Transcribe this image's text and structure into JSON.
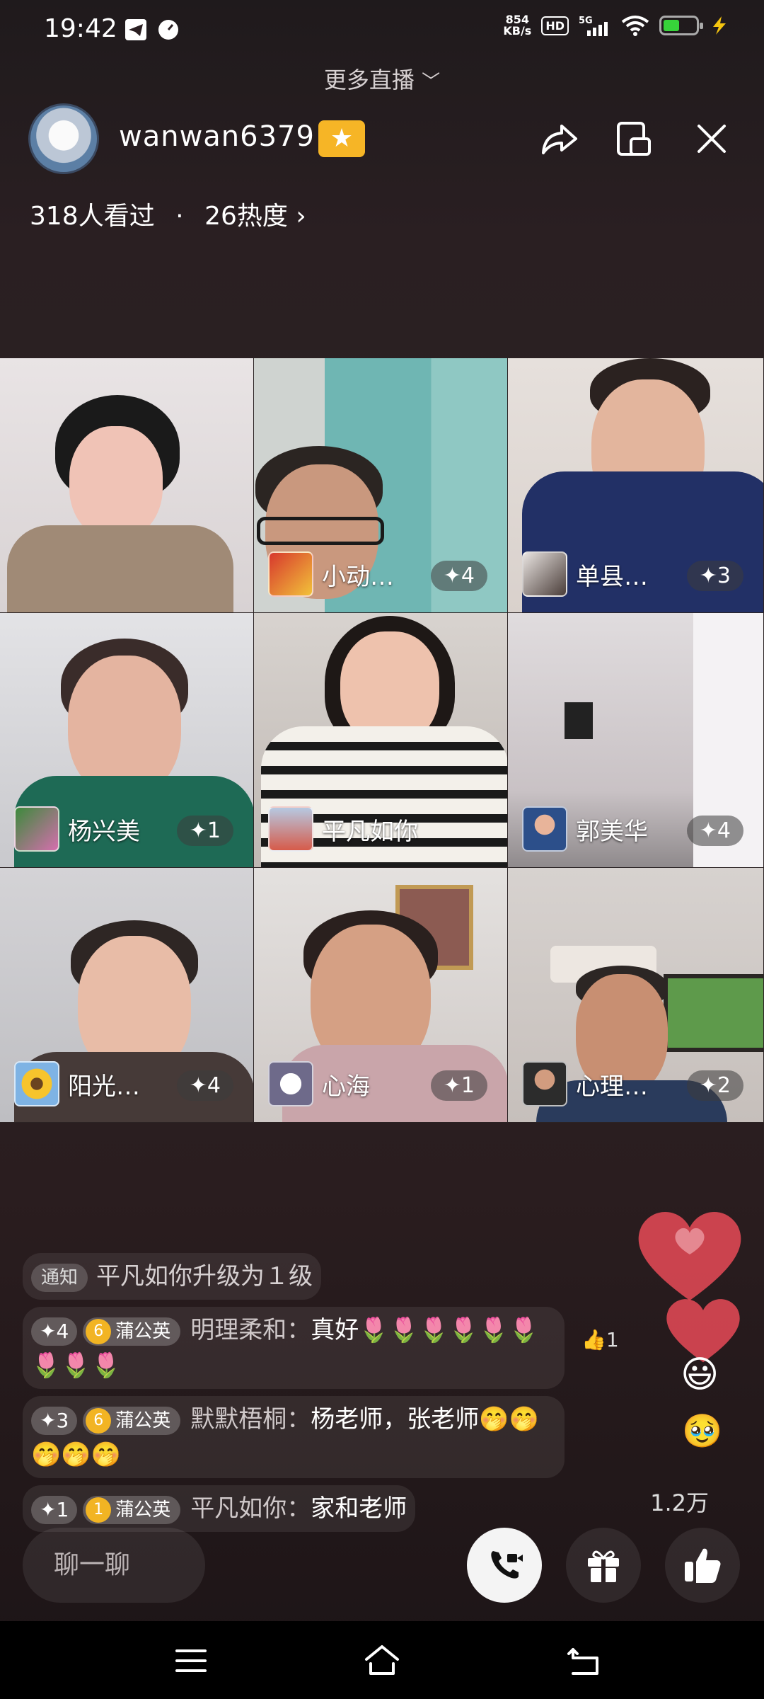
{
  "status_bar": {
    "time": "19:42",
    "net_speed_value": "854",
    "net_speed_unit": "KB/s",
    "hd": "HD",
    "network": "5G",
    "battery_level": 0.35
  },
  "top": {
    "more_live": "更多直播"
  },
  "header": {
    "host_name": "wanwan6379",
    "viewers": "318人看过",
    "separator": "·",
    "heat": "26热度"
  },
  "grid": {
    "tiles": [
      {
        "name": "",
        "level": ""
      },
      {
        "name": "小动…",
        "level": "✦4"
      },
      {
        "name": "单县…",
        "level": "✦3"
      },
      {
        "name": "杨兴美",
        "level": "✦1"
      },
      {
        "name": "平凡如你",
        "level": ""
      },
      {
        "name": "郭美华",
        "level": "✦4"
      },
      {
        "name": "阳光…",
        "level": "✦4"
      },
      {
        "name": "心海",
        "level": "✦1"
      },
      {
        "name": "心理…",
        "level": "✦2"
      }
    ]
  },
  "chat": {
    "notice": {
      "tag": "通知",
      "text": "平凡如你升级为１级"
    },
    "messages": [
      {
        "level": "✦4",
        "fan_level": "6",
        "fan_name": "蒲公英",
        "sender": "明理柔和：",
        "text": "真好",
        "emoji": "🌷🌷🌷🌷🌷🌷🌷🌷🌷"
      },
      {
        "level": "✦3",
        "fan_level": "6",
        "fan_name": "蒲公英",
        "sender": "默默梧桐：",
        "text": "杨老师，张老师",
        "emoji": "🤭🤭🤭🤭🤭"
      },
      {
        "level": "✦1",
        "fan_level": "1",
        "fan_name": "蒲公英",
        "sender": "平凡如你：",
        "text": "家和老师",
        "emoji": ""
      }
    ],
    "msg_like": "1"
  },
  "likes": {
    "count": "1.2万"
  },
  "bottom": {
    "chat_placeholder": "聊一聊"
  },
  "icons": {
    "share": "share-icon",
    "pip": "picture-in-picture-icon",
    "close": "close-icon",
    "call": "video-call-icon",
    "gift": "gift-icon",
    "like": "thumbs-up-icon"
  },
  "colors": {
    "host_badge": "#f6b526",
    "fan_badge": "#f2b423",
    "heart": "#e84a57"
  }
}
